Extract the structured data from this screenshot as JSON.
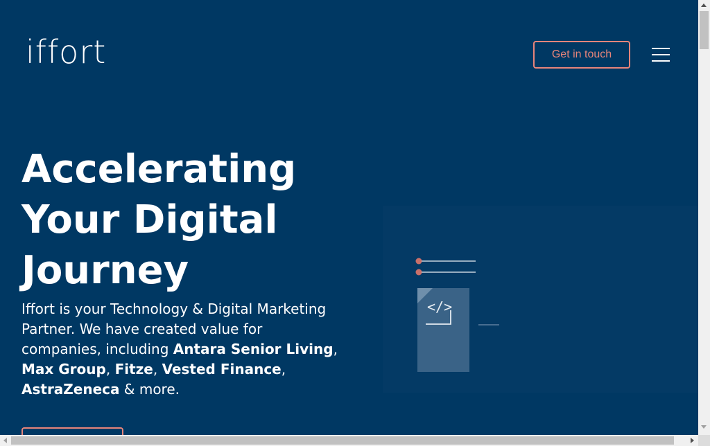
{
  "header": {
    "logo_text": "iffort",
    "cta_label": "Get in touch",
    "menu_icon": "hamburger-icon"
  },
  "hero": {
    "title_lines": [
      "Accelerating",
      "Your Digital",
      "Journey"
    ],
    "description": {
      "intro": "Iffort is your Technology & Digital Marketing Partner. We have created value for companies, including ",
      "clients": [
        "Antara Senior Living",
        "Max Group",
        "Fitze",
        "Vested Finance",
        "AstraZeneca"
      ],
      "sep": ", ",
      "outro": " & more."
    }
  },
  "illustration": {
    "code_glyph": "</>",
    "icon": "code-document-icon"
  },
  "colors": {
    "background": "#003863",
    "accent": "#e8857a",
    "panel": "#043a65",
    "doc": "#3a6387"
  }
}
